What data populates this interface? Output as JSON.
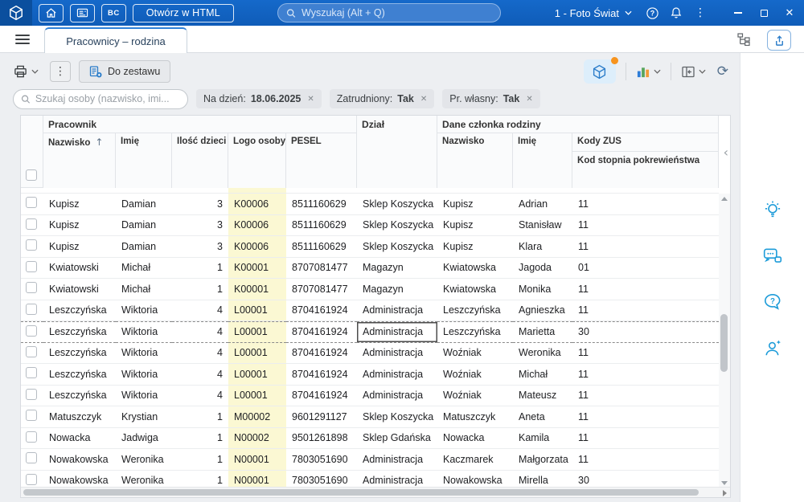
{
  "titlebar": {
    "open_in_html": "Otwórz w HTML",
    "bc_badge": "BC",
    "search_placeholder": "Wyszukaj (Alt + Q)",
    "company_selector": "1 - Foto Świat"
  },
  "tabbar": {
    "active_tab": "Pracownicy – rodzina"
  },
  "toolbar": {
    "add_to_set": "Do zestawu"
  },
  "filterbar": {
    "search_placeholder": "Szukaj osoby (nazwisko, imi...",
    "chips": [
      {
        "label": "Na dzień:",
        "value": "18.06.2025"
      },
      {
        "label": "Zatrudniony:",
        "value": "Tak"
      },
      {
        "label": "Pr. własny:",
        "value": "Tak"
      }
    ]
  },
  "grid": {
    "group_headers": [
      "Pracownik",
      "Dział",
      "Dane członka rodziny"
    ],
    "columns": [
      "Nazwisko",
      "Imię",
      "Ilość dzieci",
      "Logo osoby",
      "PESEL",
      "Nazwisko",
      "Imię",
      "Kody ZUS"
    ],
    "sub_header": "Kod stopnia pokrewieństwa",
    "rows": [
      [
        "Kupisz",
        "Damian",
        "3",
        "K00006",
        "8511160629",
        "Sklep Koszycka",
        "Kupisz",
        "Adrian",
        "11"
      ],
      [
        "Kupisz",
        "Damian",
        "3",
        "K00006",
        "8511160629",
        "Sklep Koszycka",
        "Kupisz",
        "Stanisław",
        "11"
      ],
      [
        "Kupisz",
        "Damian",
        "3",
        "K00006",
        "8511160629",
        "Sklep Koszycka",
        "Kupisz",
        "Klara",
        "11"
      ],
      [
        "Kwiatowski",
        "Michał",
        "1",
        "K00001",
        "8707081477",
        "Magazyn",
        "Kwiatowska",
        "Jagoda",
        "01"
      ],
      [
        "Kwiatowski",
        "Michał",
        "1",
        "K00001",
        "8707081477",
        "Magazyn",
        "Kwiatowska",
        "Monika",
        "11"
      ],
      [
        "Leszczyńska",
        "Wiktoria",
        "4",
        "L00001",
        "8704161924",
        "Administracja",
        "Leszczyńska",
        "Agnieszka",
        "11"
      ],
      [
        "Leszczyńska",
        "Wiktoria",
        "4",
        "L00001",
        "8704161924",
        "Administracja",
        "Leszczyńska",
        "Marietta",
        "30"
      ],
      [
        "Leszczyńska",
        "Wiktoria",
        "4",
        "L00001",
        "8704161924",
        "Administracja",
        "Woźniak",
        "Weronika",
        "11"
      ],
      [
        "Leszczyńska",
        "Wiktoria",
        "4",
        "L00001",
        "8704161924",
        "Administracja",
        "Woźniak",
        "Michał",
        "11"
      ],
      [
        "Leszczyńska",
        "Wiktoria",
        "4",
        "L00001",
        "8704161924",
        "Administracja",
        "Woźniak",
        "Mateusz",
        "11"
      ],
      [
        "Matuszczyk",
        "Krystian",
        "1",
        "M00002",
        "9601291127",
        "Sklep Koszycka",
        "Matuszczyk",
        "Aneta",
        "11"
      ],
      [
        "Nowacka",
        "Jadwiga",
        "1",
        "N00002",
        "9501261898",
        "Sklep Gdańska",
        "Nowacka",
        "Kamila",
        "11"
      ],
      [
        "Nowakowska",
        "Weronika",
        "1",
        "N00001",
        "7803051690",
        "Administracja",
        "Kaczmarek",
        "Małgorzata",
        "11"
      ],
      [
        "Nowakowska",
        "Weronika",
        "1",
        "N00001",
        "7803051690",
        "Administracja",
        "Nowakowska",
        "Mirella",
        "30"
      ]
    ],
    "focused_row": 6,
    "focused_col": 5
  },
  "icons": {
    "chip_close": "✕",
    "kebab": "⋮",
    "refresh": "⟳",
    "collapse": "‹",
    "sort_asc": "↑",
    "close": "✕"
  },
  "colors": {
    "accent": "#1366c4",
    "logo_column_highlight": "#fbf8d3",
    "notification_dot": "#f7941e"
  }
}
